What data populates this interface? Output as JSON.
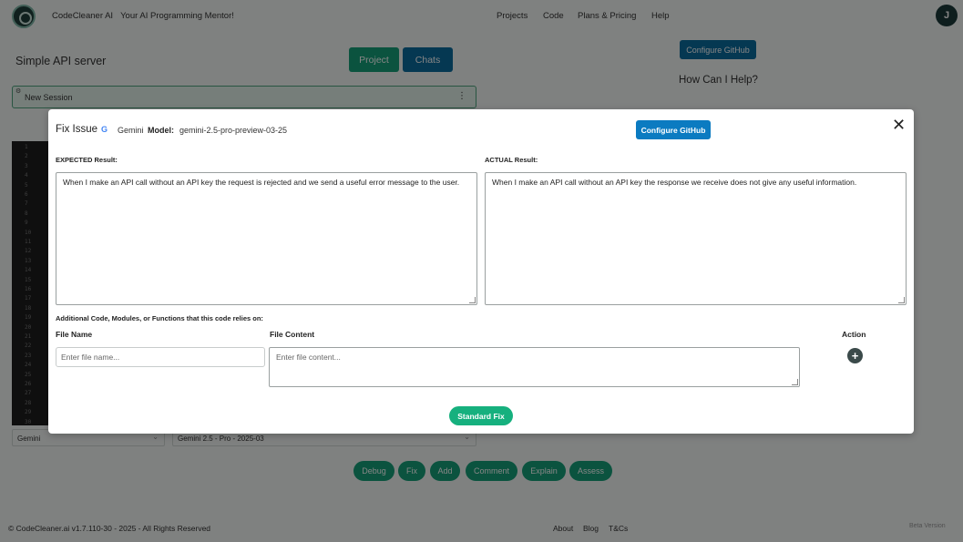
{
  "app": {
    "brand": "CodeCleaner AI",
    "tagline": "Your AI Programming Mentor!",
    "nav": [
      "Projects",
      "Code",
      "Plans & Pricing",
      "Help"
    ],
    "user_initial": "J"
  },
  "workspace": {
    "project_title": "Simple API server",
    "project_button": "Project",
    "chats_button": "Chats",
    "configure_github": "Configure GitHub",
    "help_title": "How Can I Help?",
    "session_label": "New Session",
    "session_menu": "⋮",
    "line_numbers": [
      "1",
      "2",
      "3",
      "4",
      "5",
      "6",
      "7",
      "8",
      "9",
      "10",
      "11",
      "12",
      "13",
      "14",
      "15",
      "16",
      "17",
      "18",
      "19",
      "20",
      "21",
      "22",
      "23",
      "24",
      "25",
      "26",
      "27",
      "28",
      "29",
      "30"
    ],
    "provider_select": "Gemini",
    "model_select": "Gemini 2.5 - Pro - 2025-03",
    "actions": [
      "Debug",
      "Fix",
      "Add",
      "Comment",
      "Explain",
      "Assess"
    ]
  },
  "modal": {
    "title": "Fix Issue",
    "provider_icon": "G",
    "provider": "Gemini",
    "model_key": "Model:",
    "model_value": "gemini-2.5-pro-preview-03-25",
    "configure_github": "Configure GitHub",
    "close": "✕",
    "expected_label": "EXPECTED Result:",
    "expected_value": "When I make an API call without an API key the request is rejected and we send a useful error message to the user.",
    "actual_label": "ACTUAL Result:",
    "actual_value": "When I make an API call without an API key the response we receive does not give any useful information.",
    "additional_label": "Additional Code, Modules, or Functions that this code relies on:",
    "col_file_name": "File Name",
    "col_file_content": "File Content",
    "col_action": "Action",
    "file_name_placeholder": "Enter file name...",
    "file_content_placeholder": "Enter file content...",
    "add_icon": "+",
    "standard_fix": "Standard Fix"
  },
  "footer": {
    "copyright": "© CodeCleaner.ai v1.7.110-30 - 2025 - All Rights Reserved",
    "links": [
      "About",
      "Blog",
      "T&Cs"
    ],
    "beta": "Beta Version"
  }
}
